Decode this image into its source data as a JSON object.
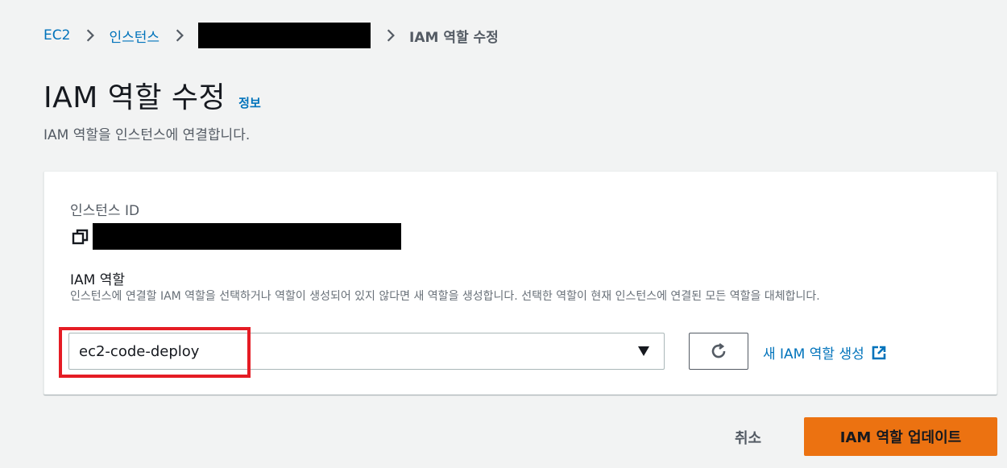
{
  "breadcrumb": {
    "items": [
      "EC2",
      "인스턴스"
    ],
    "current": "IAM 역할 수정"
  },
  "header": {
    "title": "IAM 역할 수정",
    "info_link": "정보",
    "subtitle": "IAM 역할을 인스턴스에 연결합니다."
  },
  "form": {
    "instance_id_label": "인스턴스 ID",
    "iam_role_label": "IAM 역할",
    "iam_role_description": "인스턴스에 연결할 IAM 역할을 선택하거나 역할이 생성되어 있지 않다면 새 역할을 생성합니다. 선택한 역할이 현재 인스턴스에 연결된 모든 역할을 대체합니다.",
    "selected_role": "ec2-code-deploy",
    "create_role_link": "새 IAM 역할 생성"
  },
  "footer": {
    "cancel_label": "취소",
    "update_label": "IAM 역할 업데이트"
  },
  "colors": {
    "link": "#0073bb",
    "primary_button": "#ec7211",
    "highlight": "#e51c24"
  },
  "icons": {
    "separator": "chevron-right-icon",
    "copy": "copy-icon",
    "caret": "caret-down-icon",
    "refresh": "refresh-icon",
    "external": "external-link-icon"
  }
}
